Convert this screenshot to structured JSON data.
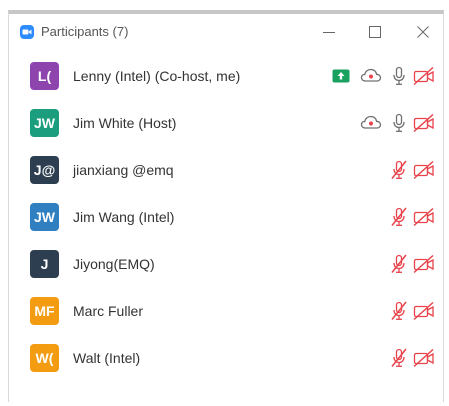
{
  "window": {
    "title": "Participants (7)"
  },
  "participants": [
    {
      "initials": "L(",
      "name": "Lenny (Intel) (Co-host, me)",
      "avatar_color": "#8e44ad",
      "sharing": true,
      "recording": true,
      "mic": "on",
      "video": "off"
    },
    {
      "initials": "JW",
      "name": "Jim White (Host)",
      "avatar_color": "#1a9e7e",
      "sharing": false,
      "recording": true,
      "mic": "on",
      "video": "off"
    },
    {
      "initials": "J@",
      "name": "jianxiang @emq",
      "avatar_color": "#2c3e50",
      "sharing": false,
      "recording": false,
      "mic": "muted",
      "video": "off"
    },
    {
      "initials": "JW",
      "name": "Jim Wang (Intel)",
      "avatar_color": "#2f7fc1",
      "sharing": false,
      "recording": false,
      "mic": "muted",
      "video": "off"
    },
    {
      "initials": "J",
      "name": "Jiyong(EMQ)",
      "avatar_color": "#2c3e50",
      "sharing": false,
      "recording": false,
      "mic": "muted",
      "video": "off"
    },
    {
      "initials": "MF",
      "name": "Marc Fuller",
      "avatar_color": "#f39c12",
      "sharing": false,
      "recording": false,
      "mic": "muted",
      "video": "off"
    },
    {
      "initials": "W(",
      "name": "Walt (Intel)",
      "avatar_color": "#f39c12",
      "sharing": false,
      "recording": false,
      "mic": "muted",
      "video": "off"
    }
  ],
  "colors": {
    "accent": "#2d8cff",
    "share_green": "#1aa160",
    "muted_red": "#e8434b",
    "icon_gray": "#707070"
  },
  "icons": {
    "app": "zoom-camera-icon",
    "share": "screen-share-icon",
    "record": "cloud-record-icon",
    "mic_on": "microphone-icon",
    "mic_muted": "microphone-muted-icon",
    "video_off": "video-off-icon"
  }
}
